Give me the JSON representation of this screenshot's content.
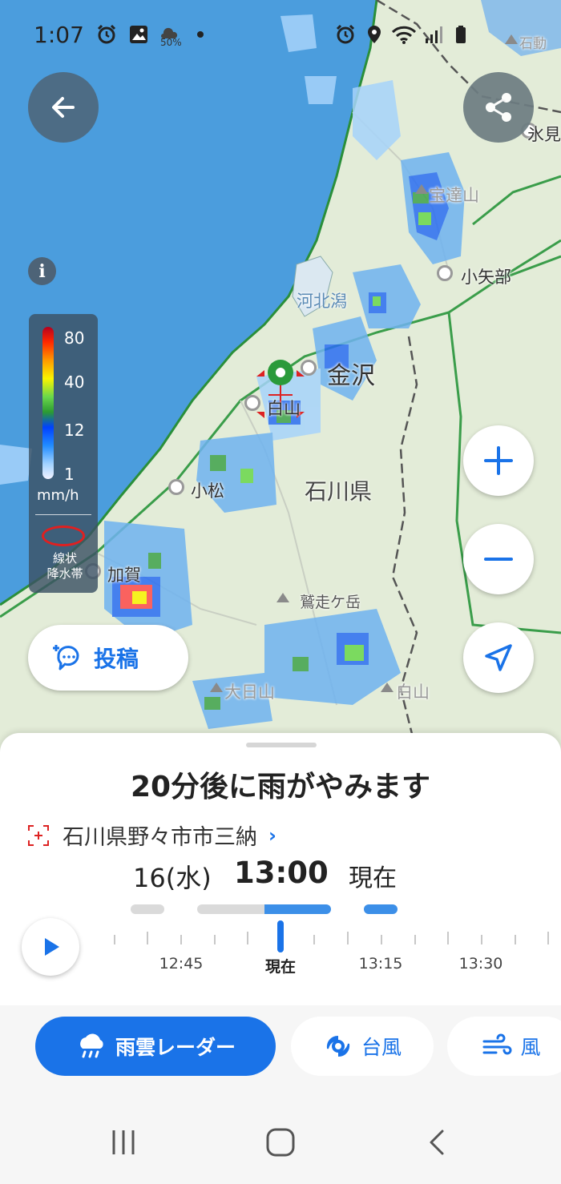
{
  "status_bar": {
    "time": "1:07",
    "battery_indicator": "50%"
  },
  "map": {
    "places": {
      "kanazawa": "金沢",
      "hakusan": "白山",
      "komatsu": "小松",
      "kaga": "加賀",
      "ishikawa": "石川県",
      "oyabe": "小矢部",
      "himi": "氷見",
      "kahokugata": "河北潟",
      "hodatsusan": "宝達山",
      "torisugatake": "鷲走ケ岳",
      "hakusan_mtn": "白山",
      "ohshoji": "大日山",
      "top_right": "石動"
    }
  },
  "legend": {
    "values": [
      "80",
      "40",
      "12",
      "1"
    ],
    "unit": "mm/h",
    "band_label": "線状\n降水帯"
  },
  "post_button": {
    "label": "投稿"
  },
  "forecast": {
    "headline": "20分後に雨がやみます",
    "location": "石川県野々市市三納",
    "date": "16(水)",
    "time": "13:00",
    "now_label": "現在"
  },
  "timeline": {
    "labels": [
      "12:45",
      "現在",
      "13:15",
      "13:30"
    ]
  },
  "tabs": {
    "radar": "雨雲レーダー",
    "typhoon": "台風",
    "wind": "風"
  },
  "colors": {
    "accent": "#1a73e8",
    "sea": "#4b9ddd",
    "land": "#e3ecd8",
    "legend_bg": "#3c5264"
  }
}
